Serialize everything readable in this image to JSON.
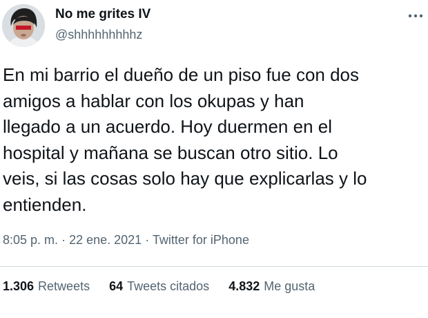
{
  "user": {
    "display_name": "No me grites IV",
    "handle": "@shhhhhhhhhz",
    "avatar_icon": "profile-avatar"
  },
  "more_icon": "more-dots-icon",
  "tweet": {
    "text": "En mi barrio el dueño de un piso fue con dos\namigos a hablar con los okupas y han\nllegado a un acuerdo. Hoy duermen en el\nhospital y mañana se buscan otro sitio. Lo\nveis, si las cosas solo hay que explicarlas y lo\nentienden."
  },
  "meta": {
    "time": "8:05 p. m.",
    "separator": "·",
    "date": "22 ene. 2021",
    "source": "Twitter for iPhone"
  },
  "stats": [
    {
      "count": "1.306",
      "label": "Retweets"
    },
    {
      "count": "64",
      "label": "Tweets citados"
    },
    {
      "count": "4.832",
      "label": "Me gusta"
    }
  ],
  "colors": {
    "text": "#0f1419",
    "secondary": "#536471",
    "divider": "#cfd9de"
  }
}
